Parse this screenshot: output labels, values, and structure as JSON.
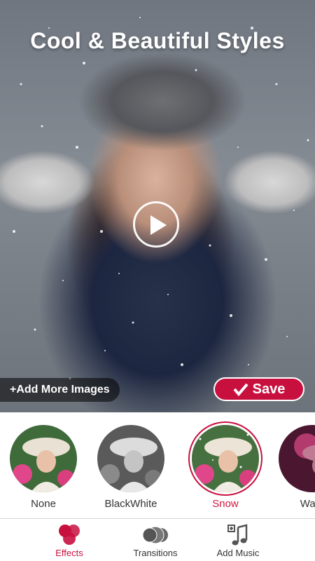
{
  "preview": {
    "title": "Cool & Beautiful Styles",
    "add_more_label": "+Add More Images",
    "save_label": "Save"
  },
  "effects": [
    {
      "label": "None",
      "active": false
    },
    {
      "label": "BlackWhite",
      "active": false
    },
    {
      "label": "Snow",
      "active": true
    },
    {
      "label": "Wate",
      "active": false
    }
  ],
  "nav": [
    {
      "label": "Effects",
      "icon": "effects-icon",
      "active": true
    },
    {
      "label": "Transitions",
      "icon": "transitions-icon",
      "active": false
    },
    {
      "label": "Add Music",
      "icon": "add-music-icon",
      "active": false
    }
  ],
  "colors": {
    "accent": "#c8103f",
    "active_label": "#d3153f"
  }
}
